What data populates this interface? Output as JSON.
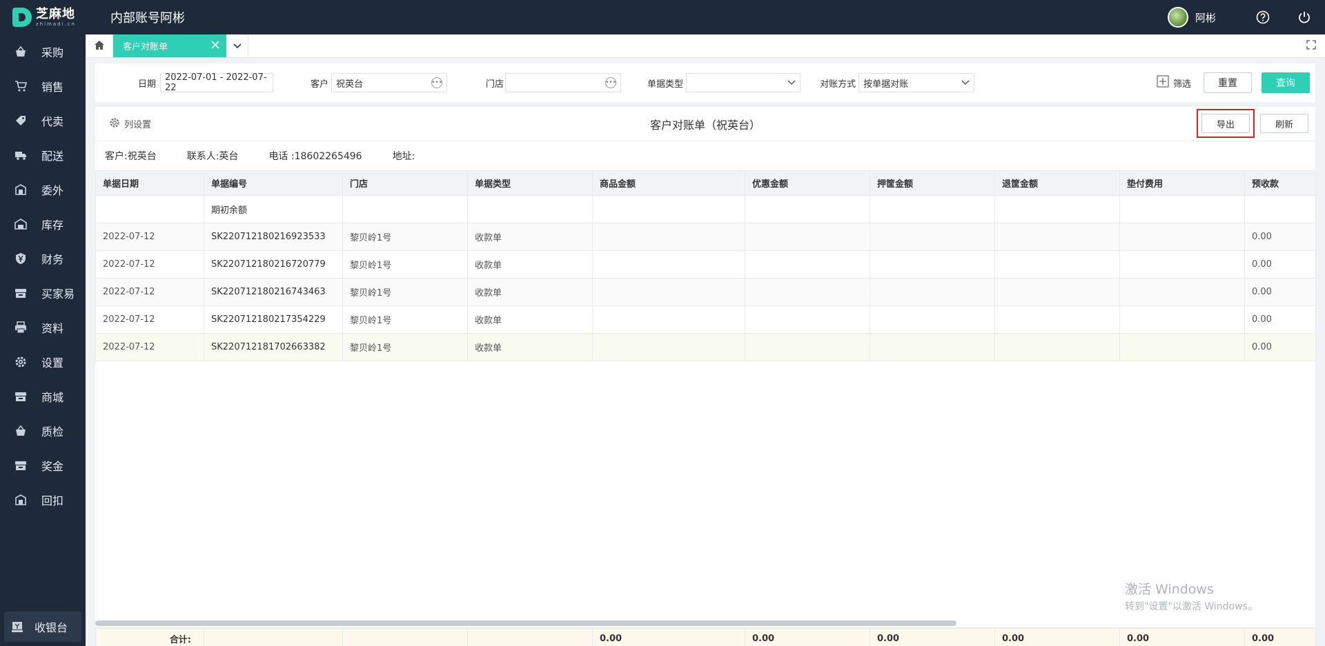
{
  "app": {
    "logo_cn": "芝麻地",
    "logo_en": "zhimadi.cn",
    "account_title": "内部账号阿彬",
    "username": "阿彬"
  },
  "sidebar": {
    "items": [
      {
        "label": "采购",
        "icon": "basket-icon"
      },
      {
        "label": "销售",
        "icon": "cart-icon"
      },
      {
        "label": "代卖",
        "icon": "tag-icon"
      },
      {
        "label": "配送",
        "icon": "truck-icon"
      },
      {
        "label": "委外",
        "icon": "building-icon"
      },
      {
        "label": "库存",
        "icon": "warehouse-icon"
      },
      {
        "label": "财务",
        "icon": "yen-shield-icon"
      },
      {
        "label": "买家易",
        "icon": "store-icon"
      },
      {
        "label": "资料",
        "icon": "printer-icon"
      },
      {
        "label": "设置",
        "icon": "gear-icon"
      },
      {
        "label": "商城",
        "icon": "shop-icon"
      },
      {
        "label": "质检",
        "icon": "basket-icon"
      },
      {
        "label": "奖金",
        "icon": "store-icon"
      },
      {
        "label": "回扣",
        "icon": "building-icon"
      }
    ],
    "cashier_label": "收银台"
  },
  "tabs": {
    "active_label": "客户对账单"
  },
  "filter": {
    "date_label": "日期",
    "date_value": "2022-07-01 - 2022-07-22",
    "customer_label": "客户",
    "customer_value": "祝英台",
    "store_label": "门店",
    "store_value": "",
    "doc_type_label": "单据类型",
    "doc_type_value": "",
    "recon_label": "对账方式",
    "recon_value": "按单据对账",
    "filter_label": "筛选",
    "reset_label": "重置",
    "query_label": "查询"
  },
  "report": {
    "column_settings_label": "列设置",
    "title": "客户对账单（祝英台）",
    "export_label": "导出",
    "refresh_label": "刷新",
    "info_customer": "客户:祝英台",
    "info_contact": "联系人:英台",
    "info_phone": "电话 :18602265496",
    "info_address": "地址:"
  },
  "table": {
    "columns": [
      "单据日期",
      "单据编号",
      "门店",
      "单据类型",
      "商品金额",
      "优惠金额",
      "押筐金额",
      "退筐金额",
      "垫付费用",
      "预收款"
    ],
    "opening_label": "期初余额",
    "rows": [
      {
        "date": "2022-07-12",
        "no": "SK220712180216923533",
        "store": "黎贝岭1号",
        "type": "收款单",
        "prepaid": "0.00"
      },
      {
        "date": "2022-07-12",
        "no": "SK220712180216720779",
        "store": "黎贝岭1号",
        "type": "收款单",
        "prepaid": "0.00"
      },
      {
        "date": "2022-07-12",
        "no": "SK220712180216743463",
        "store": "黎贝岭1号",
        "type": "收款单",
        "prepaid": "0.00"
      },
      {
        "date": "2022-07-12",
        "no": "SK220712180217354229",
        "store": "黎贝岭1号",
        "type": "收款单",
        "prepaid": "0.00"
      },
      {
        "date": "2022-07-12",
        "no": "SK220712181702663382",
        "store": "黎贝岭1号",
        "type": "收款单",
        "prepaid": "0.00"
      }
    ],
    "total_label": "合计:",
    "totals": [
      "0.00",
      "0.00",
      "0.00",
      "0.00",
      "0.00",
      "0.00"
    ]
  },
  "watermark": {
    "line1": "激活 Windows",
    "line2": "转到\"设置\"以激活 Windows。"
  },
  "colors": {
    "accent": "#2ecfb4",
    "sidebar_bg": "#1e2a3a",
    "highlight_border": "#e02020"
  }
}
